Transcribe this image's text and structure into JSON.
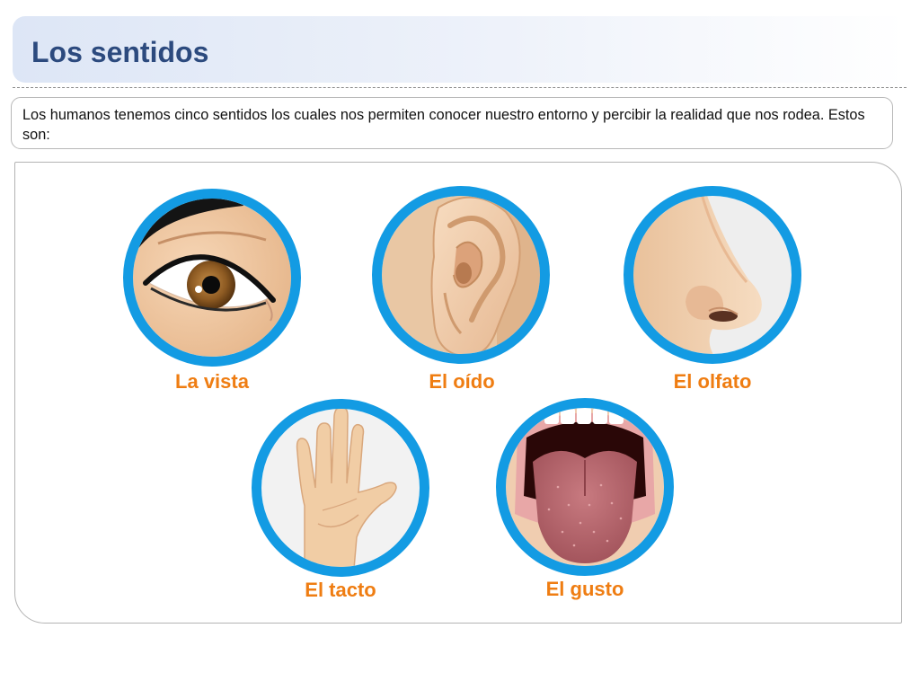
{
  "header": {
    "title": "Los sentidos"
  },
  "intro": {
    "text": "Los humanos tenemos cinco sentidos los cuales nos permiten conocer nuestro entorno y percibir la realidad que nos rodea. Estos son:"
  },
  "senses": [
    {
      "label": "La vista",
      "icon": "eye-icon"
    },
    {
      "label": "El oído",
      "icon": "ear-icon"
    },
    {
      "label": "El olfato",
      "icon": "nose-icon"
    },
    {
      "label": "El tacto",
      "icon": "hand-icon"
    },
    {
      "label": "El gusto",
      "icon": "tongue-icon"
    }
  ],
  "colors": {
    "ring": "#139be3",
    "label": "#ef7d12",
    "title": "#2c4a7e",
    "skin": "#f2c9a0"
  }
}
